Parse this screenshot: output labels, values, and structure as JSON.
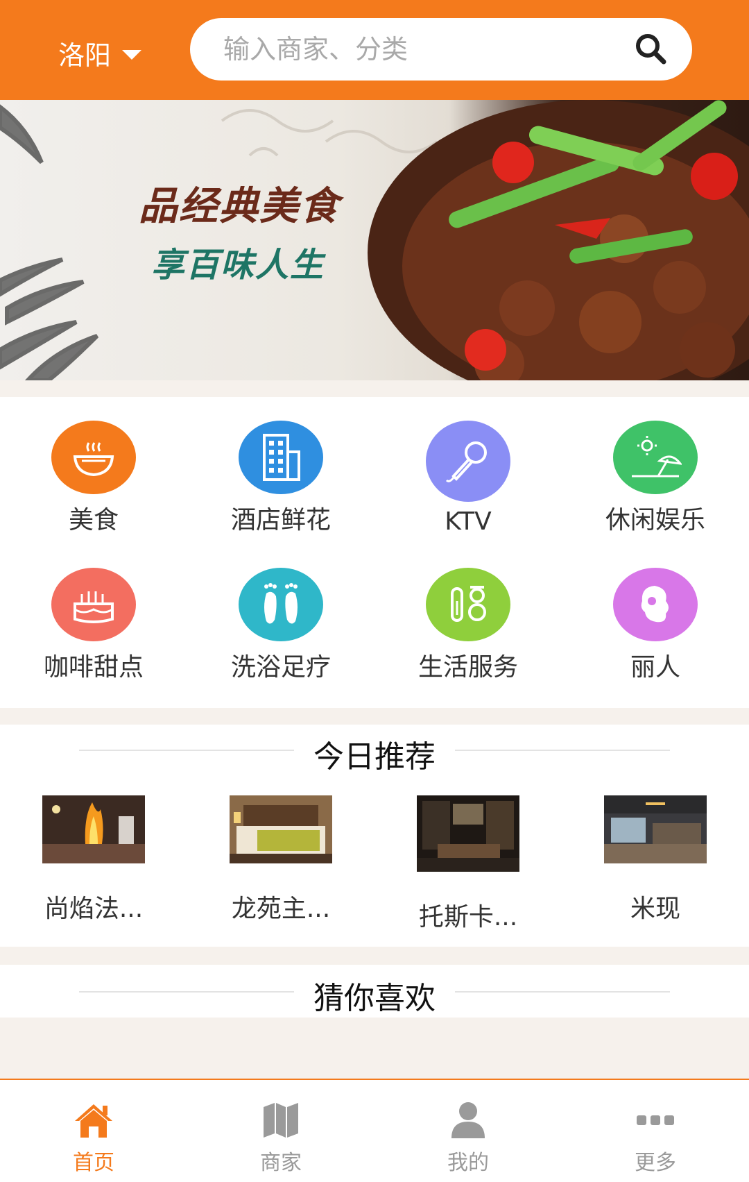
{
  "header": {
    "city": "洛阳",
    "search_placeholder": "输入商家、分类"
  },
  "banner": {
    "line1": "品经典美食",
    "line2": "享百味人生"
  },
  "categories": [
    {
      "label": "美食",
      "icon": "food-bowl-icon",
      "color": "#f47a1c"
    },
    {
      "label": "酒店鲜花",
      "icon": "hotel-building-icon",
      "color": "#2f8fe0"
    },
    {
      "label": "KTV",
      "icon": "microphone-icon",
      "color": "#8a8ef5"
    },
    {
      "label": "休闲娱乐",
      "icon": "leisure-beach-icon",
      "color": "#3fc268"
    },
    {
      "label": "咖啡甜点",
      "icon": "cake-icon",
      "color": "#f36e60"
    },
    {
      "label": "洗浴足疗",
      "icon": "footprints-icon",
      "color": "#2fb7c9"
    },
    {
      "label": "生活服务",
      "icon": "test-tubes-icon",
      "color": "#8fcf3c"
    },
    {
      "label": "丽人",
      "icon": "woman-hair-icon",
      "color": "#d877e8"
    }
  ],
  "recommend": {
    "title": "今日推荐",
    "items": [
      {
        "name": "尚焰法..."
      },
      {
        "name": "龙苑主..."
      },
      {
        "name": "托斯卡..."
      },
      {
        "name": "米现"
      }
    ]
  },
  "guess": {
    "title": "猜你喜欢"
  },
  "nav": [
    {
      "label": "首页",
      "icon": "home-icon",
      "active": true
    },
    {
      "label": "商家",
      "icon": "map-icon",
      "active": false
    },
    {
      "label": "我的",
      "icon": "user-icon",
      "active": false
    },
    {
      "label": "更多",
      "icon": "more-dots-icon",
      "active": false
    }
  ],
  "colors": {
    "accent": "#f47a1c",
    "page_bg": "#f6f1ec"
  }
}
